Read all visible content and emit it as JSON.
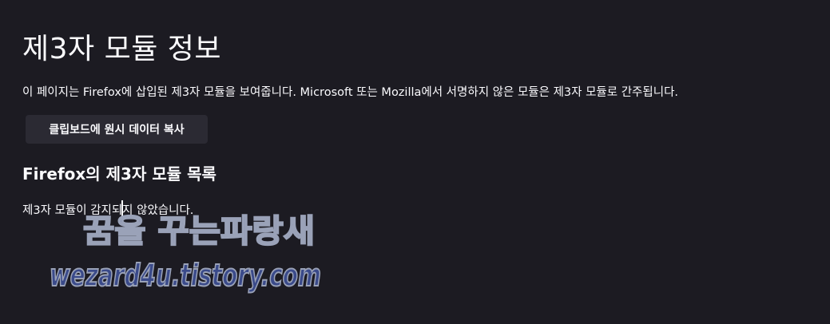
{
  "page": {
    "title": "제3자 모듈 정보",
    "description": "이 페이지는 Firefox에 삽입된 제3자 모듈을 보여줍니다. Microsoft 또는 Mozilla에서 서명하지 않은 모듈은 제3자 모듈로 간주됩니다."
  },
  "actions": {
    "copy_raw_data_label": "클립보드에 원시 데이터 복사"
  },
  "module_list": {
    "title": "Firefox의 제3자 모듈 목록",
    "empty_message": "제3자 모듈이 감지되지 않았습니다."
  },
  "watermark": {
    "line1": "꿈을 꾸는파랑새",
    "line2": "wezard4u.tistory.com",
    "fill_color": "#3a4a8a",
    "stroke_color": "#9aa2b8"
  },
  "colors": {
    "background": "#1c1b22",
    "text": "#fbfbfe",
    "button_background": "#2b2a33"
  }
}
